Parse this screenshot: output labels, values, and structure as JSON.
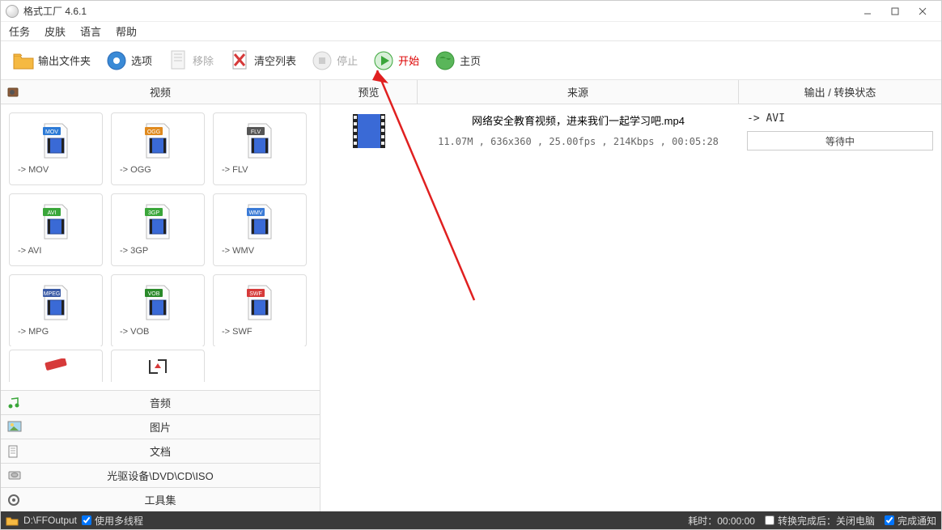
{
  "title": "格式工厂 4.6.1",
  "menu": {
    "task": "任务",
    "skin": "皮肤",
    "language": "语言",
    "help": "帮助"
  },
  "toolbar": {
    "output_folder": "输出文件夹",
    "options": "选项",
    "remove": "移除",
    "clear": "清空列表",
    "stop": "停止",
    "start": "开始",
    "home": "主页"
  },
  "left": {
    "active_tab": "视频",
    "formats": [
      {
        "label": "-> MOV",
        "badge": "MOV",
        "color": "#2c7ad6"
      },
      {
        "label": "-> OGG",
        "badge": "OGG",
        "color": "#e08a1e"
      },
      {
        "label": "-> FLV",
        "badge": "FLV",
        "color": "#555"
      },
      {
        "label": "-> AVI",
        "badge": "AVI",
        "color": "#3aa63a"
      },
      {
        "label": "-> 3GP",
        "badge": "3GP",
        "color": "#3aa63a"
      },
      {
        "label": "-> WMV",
        "badge": "WMV",
        "color": "#3a7ad6"
      },
      {
        "label": "-> MPG",
        "badge": "MPEG",
        "color": "#3a5aa6"
      },
      {
        "label": "-> VOB",
        "badge": "VOB",
        "color": "#2a8a2a"
      },
      {
        "label": "-> SWF",
        "badge": "SWF",
        "color": "#d63a3a"
      }
    ],
    "categories": {
      "audio": "音频",
      "picture": "图片",
      "document": "文档",
      "rom": "光驱设备\\DVD\\CD\\ISO",
      "toolset": "工具集"
    }
  },
  "table": {
    "preview": "预览",
    "source": "来源",
    "output": "输出 / 转换状态"
  },
  "task": {
    "filename": "网络安全教育视频，进来我们一起学习吧.mp4",
    "info": "11.07M , 636x360 , 25.00fps , 214Kbps , 00:05:28",
    "target": "-> AVI",
    "status": "等待中"
  },
  "statusbar": {
    "output_path": "D:\\FFOutput",
    "multithread": "使用多线程",
    "elapsed_label": "耗时：",
    "elapsed_value": "00:00:00",
    "after_label": "转换完成后：关闭电脑",
    "notify": "完成通知"
  }
}
